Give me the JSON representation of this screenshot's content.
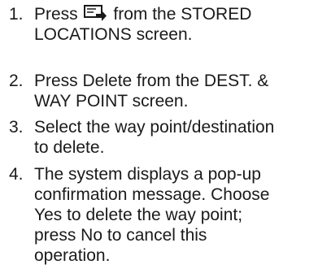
{
  "steps": [
    {
      "number": "1.",
      "icon": "stored-locations-icon",
      "lines": [
        "Press",
        "from the STORED",
        "LOCATIONS screen."
      ]
    },
    {
      "number": "2.",
      "lines": [
        "Press Delete from the DEST. &",
        "WAY POINT screen."
      ]
    },
    {
      "number": "3.",
      "lines": [
        "Select the way point/destination",
        "to delete."
      ]
    },
    {
      "number": "4.",
      "lines": [
        "The system displays a pop-up",
        "confirmation message. Choose",
        "Yes to delete the way point;",
        "press No to cancel this",
        "operation."
      ]
    }
  ]
}
